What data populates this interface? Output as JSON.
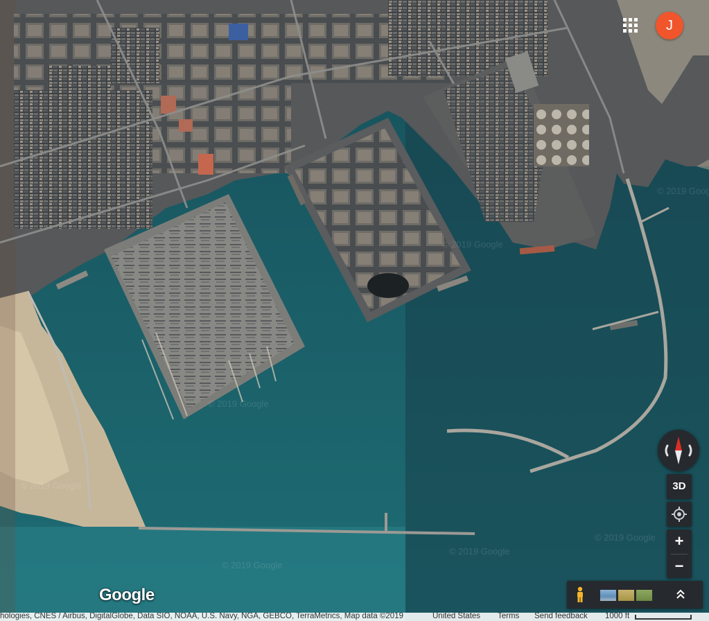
{
  "map": {
    "type": "satellite",
    "watermark_text": "© 2019 Google",
    "logo_text": "Google"
  },
  "account": {
    "avatar_letter": "J",
    "avatar_color": "#f0552b"
  },
  "controls": {
    "tilt_label": "3D",
    "zoom_in_label": "+",
    "zoom_out_label": "−",
    "compass_needle_color": "#d93025"
  },
  "footer": {
    "attribution": "hologies, CNES / Airbus, DigitalGlobe, Data SIO, NOAA, U.S. Navy, NGA, GEBCO, TerraMetrics, Map data ©2019",
    "country": "United States",
    "terms": "Terms",
    "feedback": "Send feedback",
    "scale_label": "1000 ft"
  },
  "colors": {
    "water_light": "#1f6a71",
    "water_dark": "#1d4a56",
    "land": "#5e5f5c",
    "sand": "#c7b79a"
  },
  "icons": {
    "apps": "apps-grid-icon",
    "pegman": "pegman-icon",
    "location": "my-location-icon",
    "expand": "chevron-up-double-icon"
  }
}
